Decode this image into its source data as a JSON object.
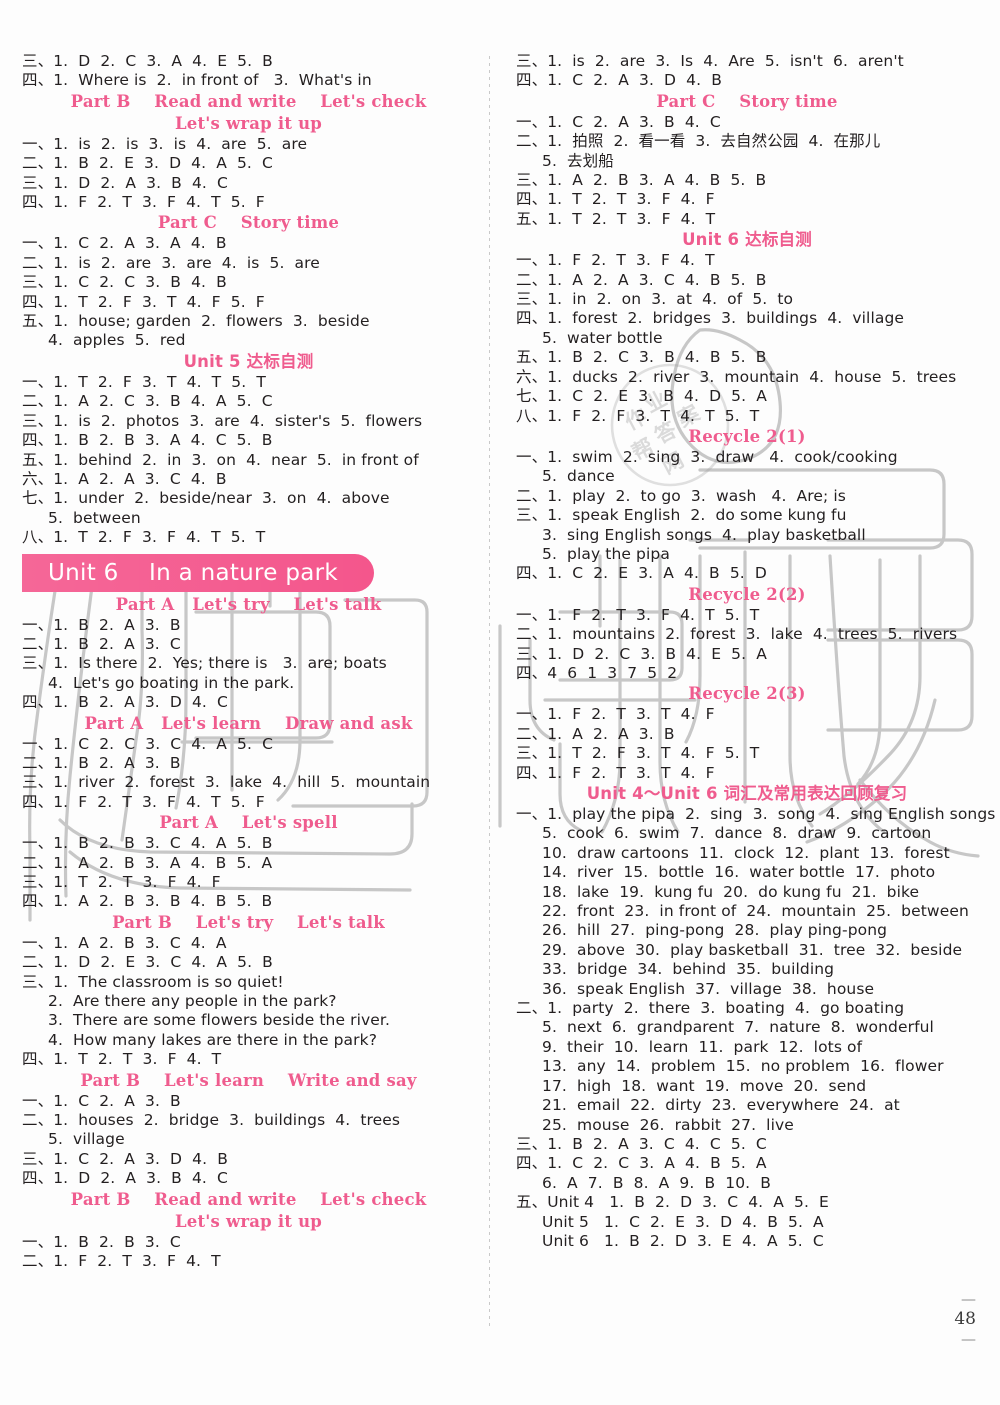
{
  "page": {
    "number": "48",
    "left_dash": "—",
    "right_dash": "—"
  },
  "left_column": [
    {
      "type": "answer",
      "text": "三、1.  D  2.  C  3.  A  4.  E  5.  B"
    },
    {
      "type": "answer",
      "text": "四、1.  Where is  2.  in front of   3.  What's in"
    },
    {
      "type": "heading",
      "text": "Part B    Read and write    Let's check"
    },
    {
      "type": "heading",
      "text": "Let's wrap it up"
    },
    {
      "type": "answer",
      "text": "一、1.  is  2.  is  3.  is  4.  are  5.  are"
    },
    {
      "type": "answer",
      "text": "二、1.  B  2.  E  3.  D  4.  A  5.  C"
    },
    {
      "type": "answer",
      "text": "三、1.  D  2.  A  3.  B  4.  C"
    },
    {
      "type": "answer",
      "text": "四、1.  F  2.  T  3.  F  4.  T  5.  F"
    },
    {
      "type": "heading",
      "text": "Part C    Story time"
    },
    {
      "type": "answer",
      "text": "一、1.  C  2.  A  3.  A  4.  B"
    },
    {
      "type": "answer",
      "text": "二、1.  is  2.  are  3.  are  4.  is  5.  are"
    },
    {
      "type": "answer",
      "text": "三、1.  C  2.  C  3.  B  4.  B"
    },
    {
      "type": "answer",
      "text": "四、1.  T  2.  F  3.  T  4.  F  5.  F"
    },
    {
      "type": "answer",
      "text": "五、1.  house; garden  2.  flowers  3.  beside"
    },
    {
      "type": "answer-indent",
      "text": "4.  apples  5.  red"
    },
    {
      "type": "heading-cn",
      "text": "Unit 5 达标自测"
    },
    {
      "type": "answer",
      "text": "一、1.  T  2.  F  3.  T  4.  T  5.  T"
    },
    {
      "type": "answer",
      "text": "二、1.  A  2.  C  3.  B  4.  A  5.  C"
    },
    {
      "type": "answer",
      "text": "三、1.  is  2.  photos  3.  are  4.  sister's  5.  flowers"
    },
    {
      "type": "answer",
      "text": "四、1.  B  2.  B  3.  A  4.  C  5.  B"
    },
    {
      "type": "answer",
      "text": "五、1.  behind  2.  in  3.  on  4.  near  5.  in front of"
    },
    {
      "type": "answer",
      "text": "六、1.  A  2.  A  3.  C  4.  B"
    },
    {
      "type": "answer",
      "text": "七、1.  under  2.  beside/near  3.  on  4.  above"
    },
    {
      "type": "answer-indent",
      "text": "5.  between"
    },
    {
      "type": "answer",
      "text": "八、1.  T  2.  F  3.  F  4.  T  5.  T"
    },
    {
      "type": "banner",
      "text": "Unit 6    In a nature park"
    },
    {
      "type": "heading",
      "text": "Part A   Let's try    Let's talk"
    },
    {
      "type": "answer",
      "text": "一、1.  B  2.  A  3.  B"
    },
    {
      "type": "answer",
      "text": "二、1.  B  2.  A  3.  C"
    },
    {
      "type": "answer",
      "text": "三、1.  Is there  2.  Yes; there is   3.  are; boats"
    },
    {
      "type": "answer-indent",
      "text": "4.  Let's go boating in the park."
    },
    {
      "type": "answer",
      "text": "四、1.  B  2.  A  3.  D  4.  C"
    },
    {
      "type": "heading",
      "text": "Part A   Let's learn    Draw and ask"
    },
    {
      "type": "answer",
      "text": "一、1.  C  2.  C  3.  C  4.  A  5.  C"
    },
    {
      "type": "answer",
      "text": "二、1.  B  2.  A  3.  B"
    },
    {
      "type": "answer",
      "text": "三、1.  river  2.  forest  3.  lake  4.  hill  5.  mountain"
    },
    {
      "type": "answer",
      "text": "四、1.  F  2.  T  3.  F  4.  T  5.  F"
    },
    {
      "type": "heading",
      "text": "Part A    Let's spell"
    },
    {
      "type": "answer",
      "text": "一、1.  B  2.  B  3.  C  4.  A  5.  B"
    },
    {
      "type": "answer",
      "text": "二、1.  A  2.  B  3.  A  4.  B  5.  A"
    },
    {
      "type": "answer",
      "text": "三、1.  T  2.  T  3.  F  4.  F"
    },
    {
      "type": "answer",
      "text": "四、1.  A  2.  B  3.  B  4.  B  5.  B"
    },
    {
      "type": "heading",
      "text": "Part B    Let's try    Let's talk"
    },
    {
      "type": "answer",
      "text": "一、1.  A  2.  B  3.  C  4.  A"
    },
    {
      "type": "answer",
      "text": "二、1.  D  2.  E  3.  C  4.  A  5.  B"
    },
    {
      "type": "answer",
      "text": "三、1.  The classroom is so quiet!"
    },
    {
      "type": "answer-indent",
      "text": "2.  Are there any people in the park?"
    },
    {
      "type": "answer-indent",
      "text": "3.  There are some flowers beside the river."
    },
    {
      "type": "answer-indent",
      "text": "4.  How many lakes are there in the park?"
    },
    {
      "type": "answer",
      "text": "四、1.  T  2.  T  3.  F  4.  T"
    },
    {
      "type": "heading",
      "text": "Part B    Let's learn    Write and say"
    },
    {
      "type": "answer",
      "text": "一、1.  C  2.  A  3.  B"
    },
    {
      "type": "answer",
      "text": "二、1.  houses  2.  bridge  3.  buildings  4.  trees"
    },
    {
      "type": "answer-indent",
      "text": "5.  village"
    },
    {
      "type": "answer",
      "text": "三、1.  C  2.  A  3.  D  4.  B"
    },
    {
      "type": "answer",
      "text": "四、1.  D  2.  A  3.  B  4.  C"
    },
    {
      "type": "heading",
      "text": "Part B    Read and write    Let's check"
    },
    {
      "type": "heading",
      "text": "Let's wrap it up"
    },
    {
      "type": "answer",
      "text": "一、1.  B  2.  B  3.  C"
    },
    {
      "type": "answer",
      "text": "二、1.  F  2.  T  3.  F  4.  T"
    }
  ],
  "right_column": [
    {
      "type": "answer",
      "text": "三、1.  is  2.  are  3.  Is  4.  Are  5.  isn't  6.  aren't"
    },
    {
      "type": "answer",
      "text": "四、1.  C  2.  A  3.  D  4.  B"
    },
    {
      "type": "heading",
      "text": "Part C    Story time"
    },
    {
      "type": "answer",
      "text": "一、1.  C  2.  A  3.  B  4.  C"
    },
    {
      "type": "answer",
      "text": "二、1.  拍照  2.  看一看  3.  去自然公园  4.  在那儿"
    },
    {
      "type": "answer-indent",
      "text": "5.  去划船"
    },
    {
      "type": "answer",
      "text": "三、1.  A  2.  B  3.  A  4.  B  5.  B"
    },
    {
      "type": "answer",
      "text": "四、1.  T  2.  T  3.  F  4.  F"
    },
    {
      "type": "answer",
      "text": "五、1.  T  2.  T  3.  F  4.  T"
    },
    {
      "type": "heading-cn",
      "text": "Unit 6 达标自测"
    },
    {
      "type": "answer",
      "text": "一、1.  F  2.  T  3.  F  4.  T"
    },
    {
      "type": "answer",
      "text": "二、1.  A  2.  A  3.  C  4.  B  5.  B"
    },
    {
      "type": "answer",
      "text": "三、1.  in  2.  on  3.  at  4.  of  5.  to"
    },
    {
      "type": "answer",
      "text": "四、1.  forest  2.  bridges  3.  buildings  4.  village"
    },
    {
      "type": "answer-indent",
      "text": "5.  water bottle"
    },
    {
      "type": "answer",
      "text": "五、1.  B  2.  C  3.  B  4.  B  5.  B"
    },
    {
      "type": "answer",
      "text": "六、1.  ducks  2.  river  3.  mountain  4.  house  5.  trees"
    },
    {
      "type": "answer",
      "text": "七、1.  C  2.  E  3.  B  4.  D  5.  A"
    },
    {
      "type": "answer",
      "text": "八、1.  F  2.  F  3.  T  4.  T  5.  T"
    },
    {
      "type": "heading",
      "text": "Recycle 2(1)"
    },
    {
      "type": "answer",
      "text": "一、1.  swim  2.  sing  3.  draw   4.  cook/cooking"
    },
    {
      "type": "answer-indent",
      "text": "5.  dance"
    },
    {
      "type": "answer",
      "text": "二、1.  play  2.  to go  3.  wash   4.  Are; is"
    },
    {
      "type": "answer",
      "text": "三、1.  speak English  2.  do some kung fu"
    },
    {
      "type": "answer-indent",
      "text": "3.  sing English songs  4.  play basketball"
    },
    {
      "type": "answer-indent",
      "text": "5.  play the pipa"
    },
    {
      "type": "answer",
      "text": "四、1.  C  2.  E  3.  A  4.  B  5.  D"
    },
    {
      "type": "heading",
      "text": "Recycle 2(2)"
    },
    {
      "type": "answer",
      "text": "一、1.  F  2.  T  3.  F  4.  T  5.  T"
    },
    {
      "type": "answer",
      "text": "二、1.  mountains  2.  forest  3.  lake  4.  trees  5.  rivers"
    },
    {
      "type": "answer",
      "text": "三、1.  D  2.  C  3.  B  4.  E  5.  A"
    },
    {
      "type": "answer",
      "text": "四、4  6  1  3  7  5  2"
    },
    {
      "type": "heading",
      "text": "Recycle 2(3)"
    },
    {
      "type": "answer",
      "text": "一、1.  F  2.  T  3.  T  4.  F"
    },
    {
      "type": "answer",
      "text": "二、1.  A  2.  A  3.  B"
    },
    {
      "type": "answer",
      "text": "三、1.  T  2.  F  3.  T  4.  F  5.  T"
    },
    {
      "type": "answer",
      "text": "四、1.  F  2.  T  3.  T  4.  F"
    },
    {
      "type": "heading-cn",
      "text": "Unit 4～Unit 6 词汇及常用表达回顾复习"
    },
    {
      "type": "answer",
      "text": "一、1.  play the pipa  2.  sing  3.  song  4.  sing English songs"
    },
    {
      "type": "answer-indent",
      "text": "5.  cook  6.  swim  7.  dance  8.  draw  9.  cartoon"
    },
    {
      "type": "answer-indent",
      "text": "10.  draw cartoons  11.  clock  12.  plant  13.  forest"
    },
    {
      "type": "answer-indent",
      "text": "14.  river  15.  bottle  16.  water bottle  17.  photo"
    },
    {
      "type": "answer-indent",
      "text": "18.  lake  19.  kung fu  20.  do kung fu  21.  bike"
    },
    {
      "type": "answer-indent",
      "text": "22.  front  23.  in front of  24.  mountain  25.  between"
    },
    {
      "type": "answer-indent",
      "text": "26.  hill  27.  ping-pong  28.  play ping-pong"
    },
    {
      "type": "answer-indent",
      "text": "29.  above  30.  play basketball  31.  tree  32.  beside"
    },
    {
      "type": "answer-indent",
      "text": "33.  bridge  34.  behind  35.  building"
    },
    {
      "type": "answer-indent",
      "text": "36.  speak English  37.  village  38.  house"
    },
    {
      "type": "answer",
      "text": "二、1.  party  2.  there  3.  boating  4.  go boating"
    },
    {
      "type": "answer-indent",
      "text": "5.  next  6.  grandparent  7.  nature  8.  wonderful"
    },
    {
      "type": "answer-indent",
      "text": "9.  their  10.  learn  11.  park  12.  lots of"
    },
    {
      "type": "answer-indent",
      "text": "13.  any  14.  problem  15.  no problem  16.  flower"
    },
    {
      "type": "answer-indent",
      "text": "17.  high  18.  want  19.  move  20.  send"
    },
    {
      "type": "answer-indent",
      "text": "21.  email  22.  dirty  23.  everywhere  24.  at"
    },
    {
      "type": "answer-indent",
      "text": "25.  mouse  26.  rabbit  27.  live"
    },
    {
      "type": "answer",
      "text": "三、1.  B  2.  A  3.  C  4.  C  5.  C"
    },
    {
      "type": "answer",
      "text": "四、1.  C  2.  C  3.  A  4.  B  5.  A"
    },
    {
      "type": "answer-indent",
      "text": "6.  A  7.  B  8.  A  9.  B  10.  B"
    },
    {
      "type": "answer",
      "text": "五、Unit 4   1.  B  2.  D  3.  C  4.  A  5.  E"
    },
    {
      "type": "answer-indent",
      "text": "Unit 5   1.  C  2.  E  3.  D  4.  B  5.  A"
    },
    {
      "type": "answer-indent",
      "text": "Unit 6   1.  B  2.  D  3.  E  4.  A  5.  C"
    }
  ],
  "colors": {
    "heading_pink": "#ef5c8e",
    "banner_pink": "#f4568c",
    "text": "#231f20"
  }
}
